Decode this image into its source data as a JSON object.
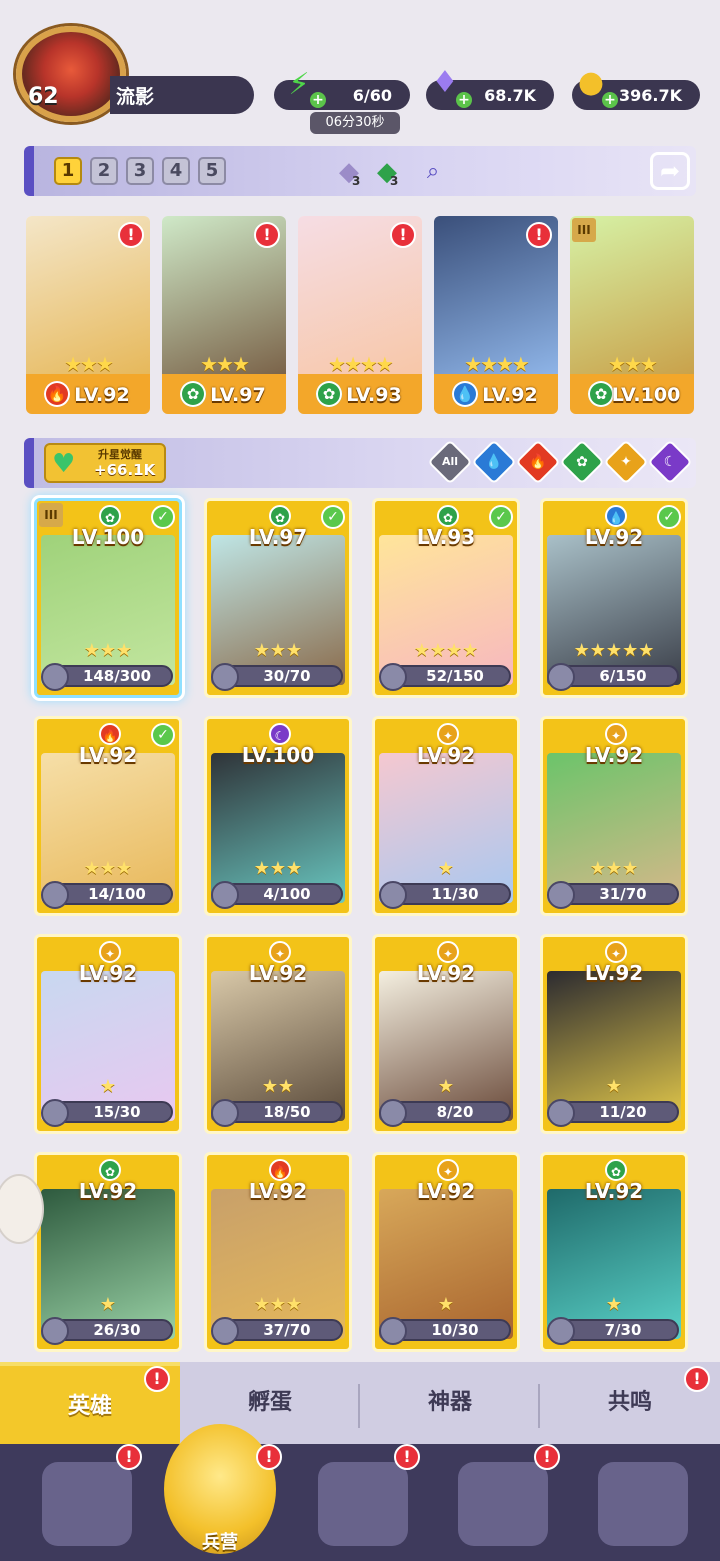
{
  "player": {
    "level": "62",
    "name": "流影"
  },
  "resources": {
    "energy": "6/60",
    "energy_timer": "06分30秒",
    "gems": "68.7K",
    "gold": "396.7K"
  },
  "team_tabs": [
    "1",
    "2",
    "3",
    "4",
    "5"
  ],
  "team_items": {
    "crystal_count": "3",
    "green_count": "3"
  },
  "team": [
    {
      "level": "LV.92",
      "element": "fire",
      "stars": "★★★",
      "alert": "!",
      "colors": [
        "#f4e6c8",
        "#e6b85a"
      ]
    },
    {
      "level": "LV.97",
      "element": "nature",
      "stars": "★★★",
      "alert": "!",
      "colors": [
        "#cfe9c8",
        "#7a6248"
      ]
    },
    {
      "level": "LV.93",
      "element": "nature",
      "stars": "★★★★",
      "alert": "!",
      "colors": [
        "#f6dde4",
        "#f7c7a8"
      ]
    },
    {
      "level": "LV.92",
      "element": "water",
      "stars": "★★★★",
      "alert": "!",
      "colors": [
        "#3a4f7a",
        "#8fb5e8"
      ]
    },
    {
      "level": "LV.100",
      "element": "nature",
      "stars": "★★★",
      "rank": "III",
      "colors": [
        "#d6f2a6",
        "#c9a14a"
      ]
    }
  ],
  "awaken": {
    "title": "升星觉醒",
    "value": "+66.1K"
  },
  "filters": {
    "all_label": "All"
  },
  "element_colors": {
    "fire": "#e23a22",
    "water": "#2a7ad6",
    "nature": "#2ea24a",
    "light": "#e8a21a",
    "dark": "#7a3ac8"
  },
  "heroes": [
    {
      "level": "LV.100",
      "shards": "148/300",
      "element": "nature",
      "stars": "★★★",
      "check": true,
      "rank": "III",
      "selected": true,
      "colors": [
        "#9fd27a",
        "#c3e6a0"
      ]
    },
    {
      "level": "LV.97",
      "shards": "30/70",
      "element": "nature",
      "stars": "★★★",
      "check": true,
      "colors": [
        "#bfe6e6",
        "#8a6a4a"
      ]
    },
    {
      "level": "LV.93",
      "shards": "52/150",
      "element": "nature",
      "stars": "★★★★",
      "check": true,
      "colors": [
        "#ffe59a",
        "#f7b7c0"
      ]
    },
    {
      "level": "LV.92",
      "shards": "6/150",
      "element": "water",
      "stars": "★★★★★",
      "check": true,
      "colors": [
        "#a9c0c8",
        "#3a3e48"
      ]
    },
    {
      "level": "LV.92",
      "shards": "14/100",
      "element": "fire",
      "stars": "★★★",
      "check": true,
      "colors": [
        "#f6dfa8",
        "#e8b85a"
      ]
    },
    {
      "level": "LV.100",
      "shards": "4/100",
      "element": "dark",
      "stars": "★★★",
      "colors": [
        "#2f3338",
        "#69c7c0"
      ]
    },
    {
      "level": "LV.92",
      "shards": "11/30",
      "element": "light",
      "stars": "★",
      "colors": [
        "#f5c8d0",
        "#a8c8f0"
      ]
    },
    {
      "level": "LV.92",
      "shards": "31/70",
      "element": "light",
      "stars": "★★★",
      "colors": [
        "#6bc46a",
        "#d6b88a"
      ]
    },
    {
      "level": "LV.92",
      "shards": "15/30",
      "element": "light",
      "stars": "★",
      "colors": [
        "#c8d8f0",
        "#e8c8f0"
      ]
    },
    {
      "level": "LV.92",
      "shards": "18/50",
      "element": "light",
      "stars": "★★",
      "colors": [
        "#d8c8a8",
        "#5a4a3a"
      ]
    },
    {
      "level": "LV.92",
      "shards": "8/20",
      "element": "light",
      "stars": "★",
      "colors": [
        "#f4efe0",
        "#6a4a3a"
      ]
    },
    {
      "level": "LV.92",
      "shards": "11/20",
      "element": "light",
      "stars": "★",
      "colors": [
        "#2c2b30",
        "#e2c84a"
      ]
    },
    {
      "level": "LV.92",
      "shards": "26/30",
      "element": "nature",
      "stars": "★",
      "colors": [
        "#2e5a3e",
        "#9ad2a6"
      ]
    },
    {
      "level": "LV.92",
      "shards": "37/70",
      "element": "fire",
      "stars": "★★★",
      "colors": [
        "#c8a06a",
        "#e5b85a"
      ]
    },
    {
      "level": "LV.92",
      "shards": "10/30",
      "element": "light",
      "stars": "★",
      "colors": [
        "#d8a85a",
        "#a8642e"
      ]
    },
    {
      "level": "LV.92",
      "shards": "7/30",
      "element": "nature",
      "stars": "★",
      "colors": [
        "#1f6a6a",
        "#5ad2c8"
      ]
    }
  ],
  "subtabs": [
    "英雄",
    "孵蛋",
    "神器",
    "共鸣"
  ],
  "nav": {
    "barracks_label": "兵营"
  },
  "alert_mark": "!",
  "check_mark": "✓"
}
